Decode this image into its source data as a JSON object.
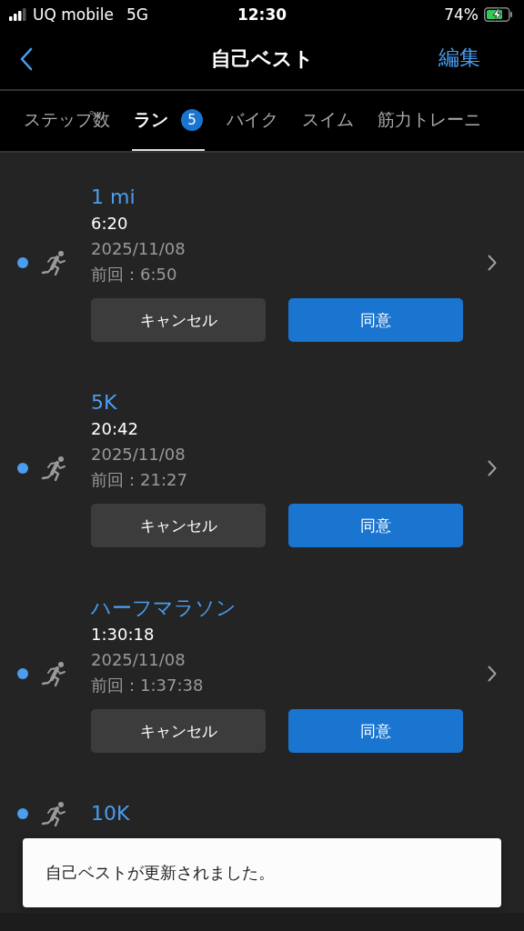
{
  "status_bar": {
    "carrier": "UQ mobile",
    "network": "5G",
    "time": "12:30",
    "battery": "74%"
  },
  "nav": {
    "title": "自己ベスト",
    "action": "編集"
  },
  "tabs": [
    {
      "label": "ステップ数",
      "selected": false
    },
    {
      "label": "ラン",
      "selected": true,
      "badge": "5"
    },
    {
      "label": "バイク",
      "selected": false
    },
    {
      "label": "スイム",
      "selected": false
    },
    {
      "label": "筋力トレーニ",
      "selected": false
    }
  ],
  "records": [
    {
      "title": "1 mi",
      "unread": true,
      "time": "6:20",
      "date": "2025/11/08",
      "previous": "前回：6:50",
      "buttons": [
        "キャンセル",
        "同意"
      ]
    },
    {
      "title": "5K",
      "unread": true,
      "time": "20:42",
      "date": "2025/11/08",
      "previous": "前回：21:27",
      "buttons": [
        "キャンセル",
        "同意"
      ]
    },
    {
      "title": "ハーフマラソン",
      "unread": true,
      "time": "1:30:18",
      "date": "2025/11/08",
      "previous": "前回：1:37:38",
      "buttons": [
        "キャンセル",
        "同意"
      ]
    },
    {
      "title": "10K",
      "unread": true
    }
  ],
  "toast": {
    "message": "自己ベストが更新されました。"
  }
}
